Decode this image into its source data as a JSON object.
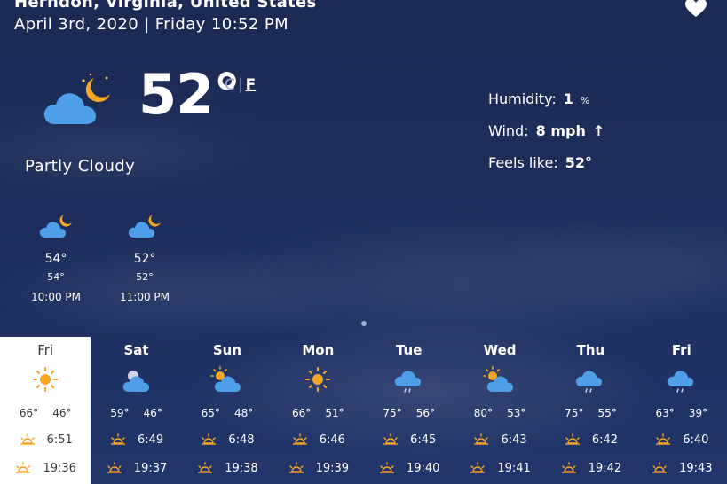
{
  "header": {
    "location": "Herndon, Virginia, United States",
    "datetime": "April 3rd, 2020 | Friday 10:52 PM"
  },
  "favorite_icon": "heart-icon",
  "current": {
    "icon": "cloud-moon-icon",
    "temperature": "52°",
    "unit_c": "C",
    "unit_separator": "|",
    "unit_f": "F",
    "condition": "Partly Cloudy"
  },
  "details": {
    "humidity_label": "Humidity:",
    "humidity_value": "1",
    "humidity_unit": "%",
    "wind_label": "Wind:",
    "wind_value": "8 mph",
    "wind_arrow": "↑",
    "feels_label": "Feels like:",
    "feels_value": "52°"
  },
  "hourly": [
    {
      "icon": "cloud-moon-icon",
      "temp": "54°",
      "feels": "54°",
      "time": "10:00 PM"
    },
    {
      "icon": "cloud-moon-icon",
      "temp": "52°",
      "feels": "52°",
      "time": "11:00 PM"
    }
  ],
  "days": [
    {
      "name": "Fri",
      "icon": "sun-icon",
      "high": "66°",
      "low": "46°",
      "sunrise": "6:51",
      "sunset": "19:36"
    },
    {
      "name": "Sat",
      "icon": "cloud-icon",
      "high": "59°",
      "low": "46°",
      "sunrise": "6:49",
      "sunset": "19:37"
    },
    {
      "name": "Sun",
      "icon": "sun-cloud-icon",
      "high": "65°",
      "low": "48°",
      "sunrise": "6:48",
      "sunset": "19:38"
    },
    {
      "name": "Mon",
      "icon": "sun-icon",
      "high": "66°",
      "low": "51°",
      "sunrise": "6:46",
      "sunset": "19:39"
    },
    {
      "name": "Tue",
      "icon": "rain-cloud-icon",
      "high": "75°",
      "low": "56°",
      "sunrise": "6:45",
      "sunset": "19:40"
    },
    {
      "name": "Wed",
      "icon": "sun-cloud-icon",
      "high": "80°",
      "low": "53°",
      "sunrise": "6:43",
      "sunset": "19:41"
    },
    {
      "name": "Thu",
      "icon": "rain-cloud-icon",
      "high": "75°",
      "low": "55°",
      "sunrise": "6:42",
      "sunset": "19:42"
    },
    {
      "name": "Fri",
      "icon": "rain-cloud-icon",
      "high": "63°",
      "low": "39°",
      "sunrise": "6:40",
      "sunset": "19:43"
    }
  ],
  "colors": {
    "background": "#1d2d57",
    "cloud": "#4f9ee8",
    "sun": "#f5a623",
    "selected_day_bg": "#ffffff"
  }
}
